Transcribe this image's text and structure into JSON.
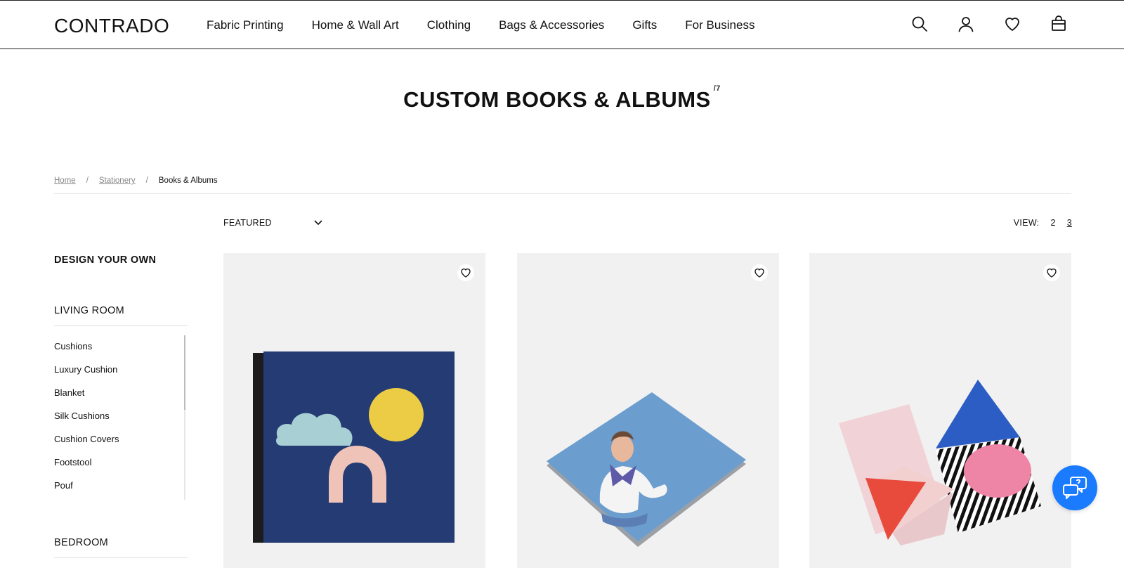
{
  "header": {
    "logo": "CONTRADO",
    "nav": [
      "Fabric Printing",
      "Home & Wall Art",
      "Clothing",
      "Bags & Accessories",
      "Gifts",
      "For Business"
    ],
    "icons": [
      "search-icon",
      "account-icon",
      "wishlist-icon",
      "bag-icon"
    ]
  },
  "page": {
    "title": "CUSTOM BOOKS & ALBUMS",
    "count": "/7"
  },
  "breadcrumb": {
    "items": [
      "Home",
      "Stationery"
    ],
    "separator": "/",
    "current": "Books & Albums"
  },
  "toolbar": {
    "sort_label": "FEATURED",
    "view_label": "VIEW:",
    "view_options": [
      "2",
      "3"
    ],
    "view_active": "3"
  },
  "sidebar": {
    "design_your_own": "DESIGN YOUR OWN",
    "living_room": {
      "title": "LIVING ROOM",
      "items": [
        "Cushions",
        "Luxury Cushion",
        "Blanket",
        "Silk Cushions",
        "Cushion Covers",
        "Footstool",
        "Pouf"
      ]
    },
    "bedroom": {
      "title": "BEDROOM"
    }
  },
  "products": [
    {
      "image": "navy-book-with-cloud-sun-arch-shapes",
      "wishlist_icon": "heart-icon"
    },
    {
      "image": "photo-book-with-woman-on-blue-cover",
      "wishlist_icon": "heart-icon"
    },
    {
      "image": "geometric-pattern-books-pink-blue-red",
      "wishlist_icon": "heart-icon"
    }
  ],
  "chat": {
    "icon": "chat-help-icon"
  },
  "colors": {
    "accent": "#1a7bff",
    "card_bg": "#f1f1f1",
    "navy": "#243b74",
    "text": "#111111"
  }
}
